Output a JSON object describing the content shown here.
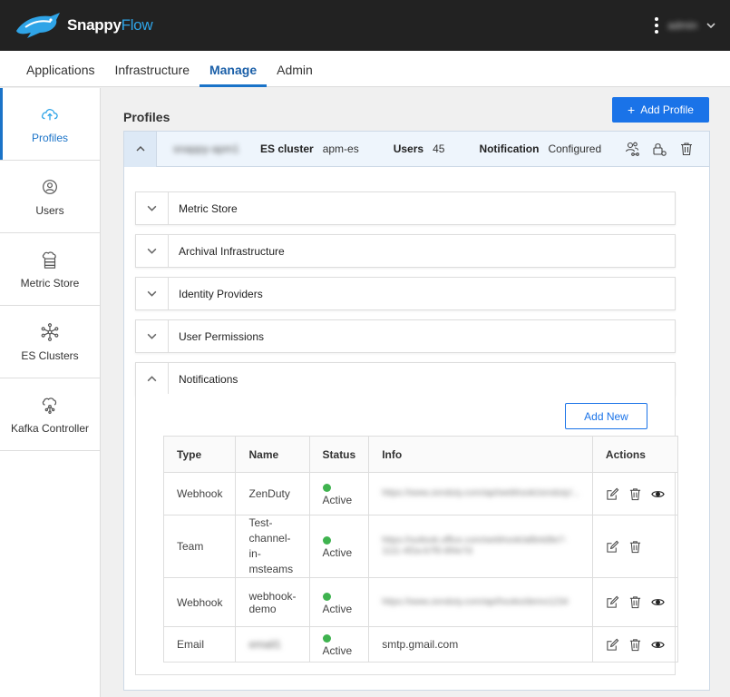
{
  "app": {
    "brand_part1": "Snappy",
    "brand_part2": "Flow",
    "username": "admin"
  },
  "nav": {
    "tabs": [
      "Applications",
      "Infrastructure",
      "Manage",
      "Admin"
    ],
    "active": "Manage"
  },
  "sidebar": {
    "items": [
      {
        "label": "Profiles",
        "icon": "cloud-upload-icon"
      },
      {
        "label": "Users",
        "icon": "user-circle-icon"
      },
      {
        "label": "Metric Store",
        "icon": "cloud-server-icon"
      },
      {
        "label": "ES Clusters",
        "icon": "network-icon"
      },
      {
        "label": "Kafka Controller",
        "icon": "cloud-network-icon"
      }
    ]
  },
  "page": {
    "title": "Profiles",
    "add_profile_label": "Add Profile"
  },
  "profile": {
    "name": "snappy-apm1",
    "es_cluster_label": "ES cluster",
    "es_cluster_value": "apm-es",
    "users_label": "Users",
    "users_value": "45",
    "notification_label": "Notification",
    "notification_value": "Configured"
  },
  "accordions": [
    "Metric Store",
    "Archival Infrastructure",
    "Identity Providers",
    "User Permissions",
    "Notifications"
  ],
  "notifications": {
    "add_new_label": "Add New",
    "columns": [
      "Type",
      "Name",
      "Status",
      "Info",
      "Actions"
    ],
    "rows": [
      {
        "type": "Webhook",
        "name": "ZenDuty",
        "status": "Active",
        "info": "https://www.zenduty.com/api/webhook/zenduty/...",
        "actions": [
          "edit",
          "delete",
          "view"
        ]
      },
      {
        "type": "Team",
        "name": "Test-channel-in-msteams",
        "status": "Active",
        "info": "https://outlook.office.com/webhook/a8b4d9e7-1111-4f2a-b7f0-8f4e7d",
        "actions": [
          "edit",
          "delete"
        ]
      },
      {
        "type": "Webhook",
        "name": "webhook-demo",
        "status": "Active",
        "info": "https://www.zenduty.com/api/hooks/demo1234",
        "actions": [
          "edit",
          "delete",
          "view"
        ]
      },
      {
        "type": "Email",
        "name": "email1",
        "status": "Active",
        "info": "smtp.gmail.com",
        "actions": [
          "edit",
          "delete",
          "view"
        ]
      }
    ]
  },
  "colors": {
    "primary": "#1a73e8",
    "active_status": "#3fb34f",
    "topbar": "#222222"
  }
}
